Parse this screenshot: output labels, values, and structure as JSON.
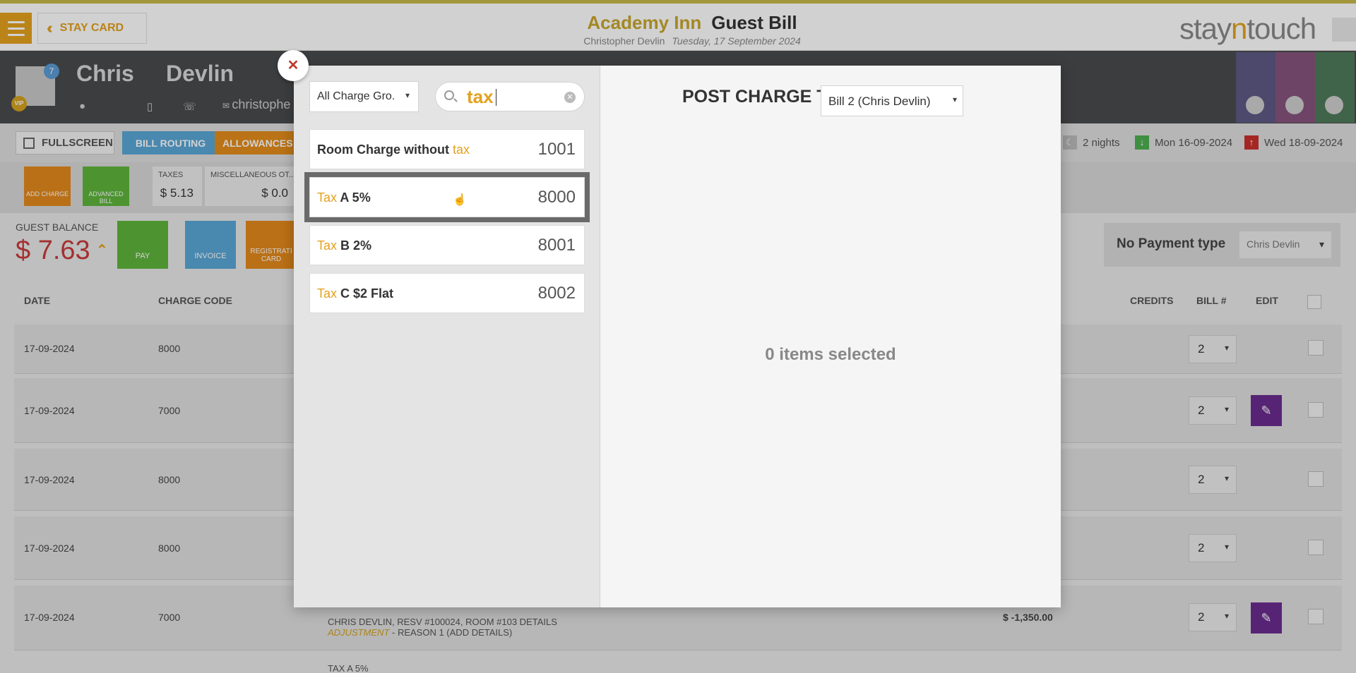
{
  "header": {
    "back_label": "STAY CARD",
    "hotel": "Academy Inn",
    "page_title": "Guest Bill",
    "guest_full_name": "Christopher Devlin",
    "date": "Tuesday, 17 September 2024",
    "brand_prefix": "stay",
    "brand_accent": "n",
    "brand_suffix": "touch"
  },
  "guest": {
    "first_name": "Chris",
    "last_name": "Devlin",
    "email_fragment": "christophe",
    "avatar_badge": "7",
    "vip": "VIP"
  },
  "toolbar": {
    "fullscreen": "FULLSCREEN",
    "bill_routing": "BILL ROUTING",
    "allowances": "ALLOWANCES",
    "nights": "2 nights",
    "arrival": "Mon 16-09-2024",
    "departure": "Wed 18-09-2024"
  },
  "summary": {
    "add_charge": "ADD CHARGE",
    "advanced_bill": "ADVANCED BILL",
    "taxes_label": "TAXES",
    "taxes_value": "$ 5.13",
    "misc_label": "MISCELLANEOUS OT...",
    "misc_value": "$ 0.0"
  },
  "balance": {
    "label": "GUEST BALANCE",
    "value": "$ 7.63",
    "pay": "PAY",
    "invoice": "INVOICE",
    "registration": "REGISTRATI CARD"
  },
  "payment": {
    "label": "No Payment type",
    "selected": "Chris Devlin"
  },
  "table": {
    "headers": [
      "DATE",
      "CHARGE CODE",
      "CREDITS",
      "BILL #",
      "EDIT"
    ],
    "rows": [
      {
        "date": "17-09-2024",
        "code": "8000",
        "bill": "2"
      },
      {
        "date": "17-09-2024",
        "code": "7000",
        "bill": "2"
      },
      {
        "date": "17-09-2024",
        "code": "8000",
        "bill": "2"
      },
      {
        "date": "17-09-2024",
        "code": "8000",
        "bill": "2"
      },
      {
        "date": "17-09-2024",
        "code": "7000",
        "bill": "2"
      }
    ],
    "detail_line1": "CHRIS DEVLIN, RESV #100024, ROOM #103 DETAILS",
    "detail_adjustment": "ADJUSTMENT",
    "detail_reason": "- REASON 1 (ADD DETAILS)",
    "detail_credit": "$ -1,350.00",
    "next_row_text": "TAX A 5%"
  },
  "modal": {
    "close": "✕",
    "charge_group": "All Charge Gro.",
    "search_value": "tax",
    "items": [
      {
        "pre": "Room Charge without ",
        "hl": "tax",
        "post": "",
        "code": "1001"
      },
      {
        "pre": "",
        "hl": "Tax",
        "post": " A 5%",
        "code": "8000"
      },
      {
        "pre": "",
        "hl": "Tax",
        "post": " B 2%",
        "code": "8001"
      },
      {
        "pre": "",
        "hl": "Tax",
        "post": " C $2 Flat",
        "code": "8002"
      }
    ],
    "post_charge_label": "POST CHARGE TO",
    "bill_selected": "Bill 2   (Chris Devlin)",
    "empty_state": "0 items selected"
  }
}
